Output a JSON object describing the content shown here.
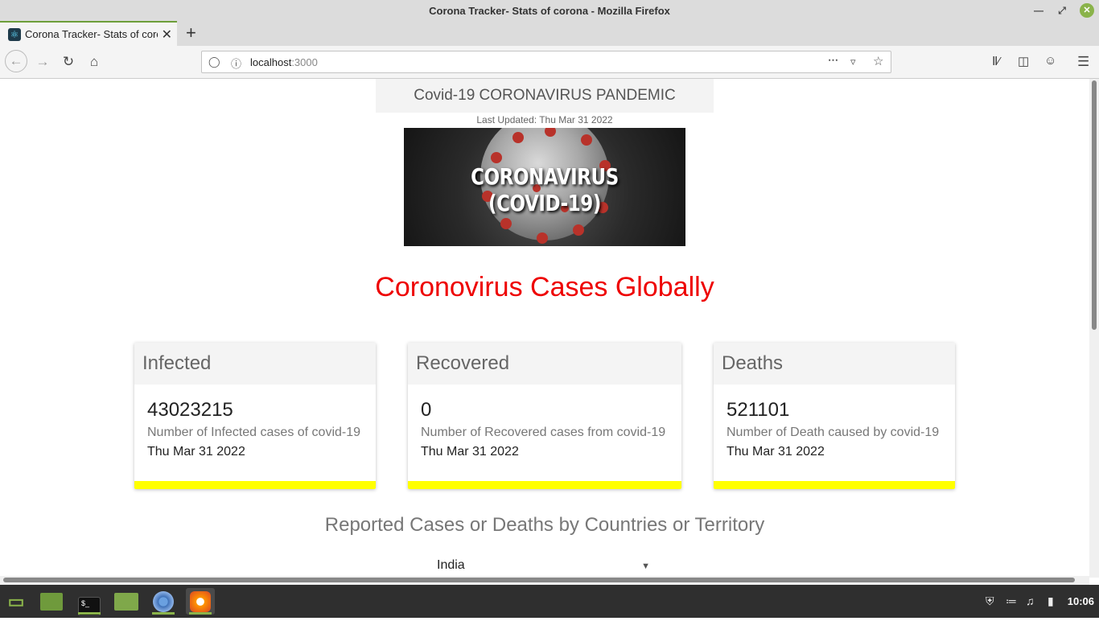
{
  "window": {
    "title": "Corona Tracker- Stats of corona - Mozilla Firefox"
  },
  "tab": {
    "title": "Corona Tracker- Stats of corona"
  },
  "address": {
    "host": "localhost",
    "port": ":3000"
  },
  "page": {
    "header": "Covid-19 CORONAVIRUS PANDEMIC",
    "last_updated": "Last Updated: Thu Mar 31 2022",
    "banner_text": "CORONAVIRUS (COVID-19)",
    "global_title": "Coronovirus Cases Globally",
    "cards": [
      {
        "title": "Infected",
        "value": "43023215",
        "description": "Number of Infected cases of covid-19",
        "date": "Thu Mar 31 2022"
      },
      {
        "title": "Recovered",
        "value": "0",
        "description": "Number of Recovered cases from covid-19",
        "date": "Thu Mar 31 2022"
      },
      {
        "title": "Deaths",
        "value": "521101",
        "description": "Number of Death caused by covid-19",
        "date": "Thu Mar 31 2022"
      }
    ],
    "section_title": "Reported Cases or Deaths by Countries or Territory",
    "country_selected": "India"
  },
  "taskbar": {
    "clock": "10:06"
  },
  "colors": {
    "accent_red": "#ee0000",
    "card_bar": "#ffff00",
    "mint_green": "#8ab34a"
  }
}
